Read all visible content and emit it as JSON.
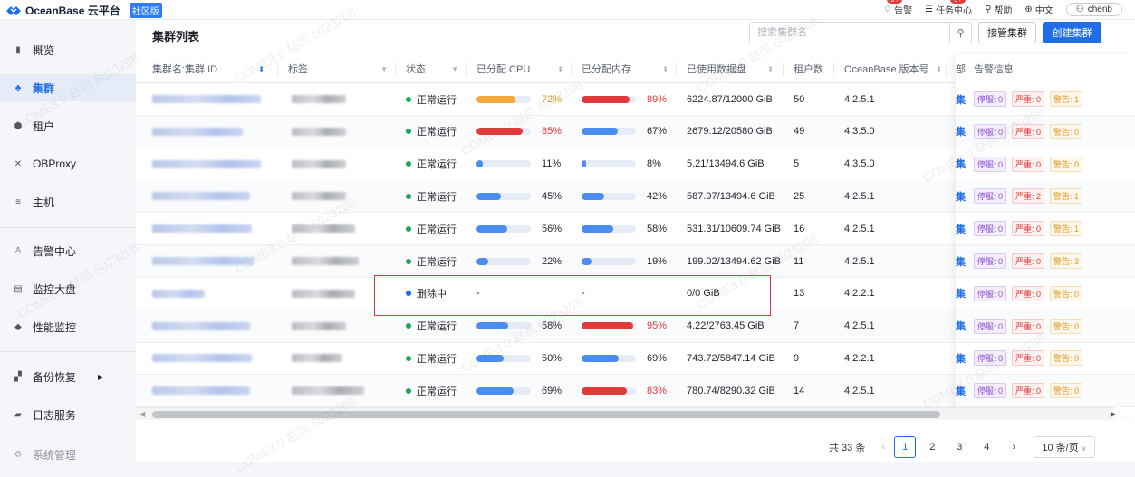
{
  "app": {
    "logo_text": "OceanBase 云平台",
    "edition": "社区版"
  },
  "topnav": {
    "alerts": "告警",
    "alerts_badge": "9+",
    "tasks": "任务中心",
    "tasks_badge": "9+",
    "help": "帮助",
    "language": "中文",
    "user": "chenb"
  },
  "sidebar": {
    "items": [
      {
        "label": "概览",
        "icon": "bar-chart-icon"
      },
      {
        "label": "集群",
        "icon": "cluster-icon",
        "active": true
      },
      {
        "label": "租户",
        "icon": "tenant-icon"
      },
      {
        "label": "OBProxy",
        "icon": "proxy-icon"
      },
      {
        "label": "主机",
        "icon": "host-icon"
      },
      {
        "label": "告警中心",
        "icon": "alert-icon"
      },
      {
        "label": "监控大盘",
        "icon": "dashboard-icon"
      },
      {
        "label": "性能监控",
        "icon": "shield-icon"
      },
      {
        "label": "备份恢复",
        "icon": "backup-icon"
      },
      {
        "label": "日志服务",
        "icon": "log-icon"
      },
      {
        "label": "系统管理",
        "icon": "settings-icon"
      }
    ]
  },
  "page": {
    "title": "集群列表",
    "search_placeholder": "搜索集群名",
    "btn_takeover": "接管集群",
    "btn_create": "创建集群"
  },
  "table": {
    "columns": [
      "集群名:集群 ID",
      "标签",
      "状态",
      "已分配 CPU",
      "已分配内存",
      "已使用数据盘",
      "租户数",
      "OceanBase 版本号",
      "部",
      "告警信息"
    ],
    "rows": [
      {
        "status": "正常运行",
        "cpu": "72%",
        "cpu_v": 0.72,
        "cpu_color": "#f0a93b",
        "cpu_cls": "warn",
        "mem": "89%",
        "mem_v": 0.89,
        "mem_color": "#e03a3a",
        "mem_cls": "danger",
        "disk": "6224.87/12000 GiB",
        "tenants": "50",
        "version": "4.2.5.1",
        "p": "停服: 0",
        "s": "严重: 0",
        "w": "警告: 1"
      },
      {
        "status": "正常运行",
        "cpu": "85%",
        "cpu_v": 0.85,
        "cpu_color": "#e03a3a",
        "cpu_cls": "danger",
        "mem": "67%",
        "mem_v": 0.67,
        "mem_color": "#4a8cf0",
        "mem_cls": "",
        "disk": "2679.12/20580 GiB",
        "tenants": "49",
        "version": "4.3.5.0",
        "p": "停服: 0",
        "s": "严重: 0",
        "w": "警告: 0"
      },
      {
        "status": "正常运行",
        "cpu": "11%",
        "cpu_v": 0.11,
        "cpu_color": "#4a8cf0",
        "cpu_cls": "",
        "mem": "8%",
        "mem_v": 0.08,
        "mem_color": "#4a8cf0",
        "mem_cls": "",
        "disk": "5.21/13494.6 GiB",
        "tenants": "5",
        "version": "4.3.5.0",
        "p": "停服: 0",
        "s": "严重: 0",
        "w": "警告: 0"
      },
      {
        "status": "正常运行",
        "cpu": "45%",
        "cpu_v": 0.45,
        "cpu_color": "#4a8cf0",
        "cpu_cls": "",
        "mem": "42%",
        "mem_v": 0.42,
        "mem_color": "#4a8cf0",
        "mem_cls": "",
        "disk": "587.97/13494.6 GiB",
        "tenants": "25",
        "version": "4.2.5.1",
        "p": "停服: 0",
        "s": "严重: 2",
        "w": "警告: 1"
      },
      {
        "status": "正常运行",
        "cpu": "56%",
        "cpu_v": 0.56,
        "cpu_color": "#4a8cf0",
        "cpu_cls": "",
        "mem": "58%",
        "mem_v": 0.58,
        "mem_color": "#4a8cf0",
        "mem_cls": "",
        "disk": "531.31/10609.74 GiB",
        "tenants": "16",
        "version": "4.2.5.1",
        "p": "停服: 0",
        "s": "严重: 0",
        "w": "警告: 1"
      },
      {
        "status": "正常运行",
        "cpu": "22%",
        "cpu_v": 0.22,
        "cpu_color": "#4a8cf0",
        "cpu_cls": "",
        "mem": "19%",
        "mem_v": 0.19,
        "mem_color": "#4a8cf0",
        "mem_cls": "",
        "disk": "199.02/13494.62 GiB",
        "tenants": "11",
        "version": "4.2.5.1",
        "p": "停服: 0",
        "s": "严重: 0",
        "w": "警告: 3"
      },
      {
        "status": "删除中",
        "deleting": true,
        "cpu": "-",
        "mem": "-",
        "disk": "0/0 GiB",
        "tenants": "13",
        "version": "4.2.2.1",
        "p": "停服: 0",
        "s": "严重: 0",
        "w": "警告: 0"
      },
      {
        "status": "正常运行",
        "cpu": "58%",
        "cpu_v": 0.58,
        "cpu_color": "#4a8cf0",
        "cpu_cls": "",
        "mem": "95%",
        "mem_v": 0.95,
        "mem_color": "#e03a3a",
        "mem_cls": "danger",
        "disk": "4.22/2763.45 GiB",
        "tenants": "7",
        "version": "4.2.5.1",
        "p": "停服: 0",
        "s": "严重: 0",
        "w": "警告: 0"
      },
      {
        "status": "正常运行",
        "cpu": "50%",
        "cpu_v": 0.5,
        "cpu_color": "#4a8cf0",
        "cpu_cls": "",
        "mem": "69%",
        "mem_v": 0.69,
        "mem_color": "#4a8cf0",
        "mem_cls": "",
        "disk": "743.72/5847.14 GiB",
        "tenants": "9",
        "version": "4.2.2.1",
        "p": "停服: 0",
        "s": "严重: 0",
        "w": "警告: 0"
      },
      {
        "status": "正常运行",
        "cpu": "69%",
        "cpu_v": 0.69,
        "cpu_color": "#4a8cf0",
        "cpu_cls": "",
        "mem": "83%",
        "mem_v": 0.83,
        "mem_color": "#e03a3a",
        "mem_cls": "danger",
        "disk": "780.74/8290.32 GiB",
        "tenants": "14",
        "version": "4.2.5.1",
        "p": "停服: 0",
        "s": "严重: 0",
        "w": "警告: 0"
      }
    ],
    "deploy_cell": "集"
  },
  "pagination": {
    "total": "共 33 条",
    "pages": [
      "1",
      "2",
      "3",
      "4"
    ],
    "current": "1",
    "page_size": "10 条/页"
  },
  "watermark": "COME3.0 赵凯 6023208"
}
